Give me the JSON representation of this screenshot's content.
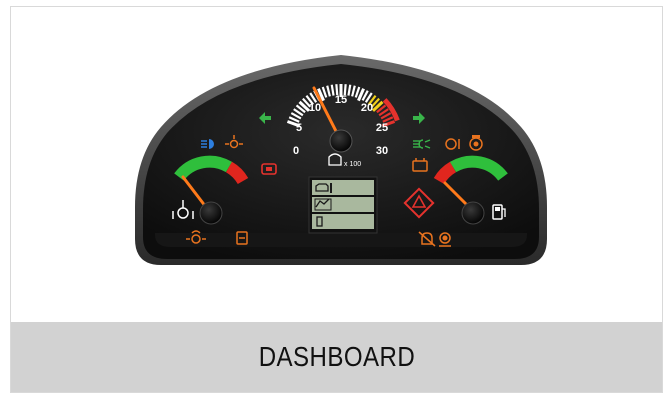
{
  "caption": {
    "title": "DASHBOARD"
  },
  "tachometer": {
    "scale_labels": [
      "0",
      "5",
      "10",
      "15",
      "20",
      "25",
      "30"
    ],
    "unit_label": "x 100",
    "reading": 10
  },
  "left_gauge": {
    "name": "engine-coolant-temperature",
    "colors": [
      "#2fbf3c",
      "#e0261e"
    ]
  },
  "right_gauge": {
    "name": "fuel-level",
    "colors": [
      "#2fbf3c",
      "#e0261e"
    ]
  },
  "warning_icons": [
    "left-turn-signal-icon",
    "right-turn-signal-icon",
    "high-beam-icon",
    "position-light-icon",
    "brake-warning-icon",
    "battery-warning-icon",
    "fog-light-icon",
    "brake-wear-icon",
    "parking-brake-icon",
    "hazard-warning-icon",
    "preheat-icon",
    "oil-level-icon",
    "cab-lock-icon",
    "buzzer-mute-icon",
    "transmission-icon",
    "coolant-temperature-icon",
    "fuel-icon"
  ],
  "accent_colors": {
    "indicator_green": "#39b54a",
    "indicator_orange": "#e8731f",
    "indicator_red": "#e5322d",
    "indicator_blue": "#2d7fe0",
    "lcd_green": "#a9b89e"
  }
}
